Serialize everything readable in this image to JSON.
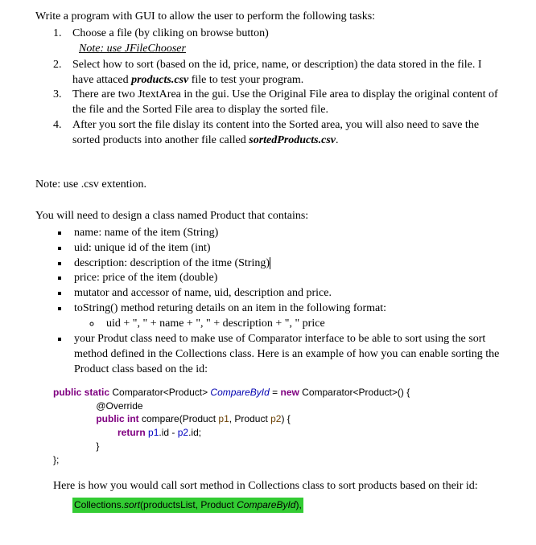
{
  "intro": "Write a program with GUI to allow the user to perform the following tasks:",
  "items": {
    "i1a": "Choose a file (by cliking on browse button)",
    "i1_note": "Note: use JFileChooser",
    "i2a": "Select how to sort (based on the id, price, name, or description) the data stored in the file. I have attaced ",
    "i2_prod": "products.csv",
    "i2b": " file to test your program.",
    "i3": "There are two JtextArea in the gui. Use the Original File area to display the original content of the file and the Sorted File area to display the sorted file.",
    "i4a": "After you sort the file dislay its content into the Sorted area, you will also need to save the sorted products into another file called ",
    "i4_sorted": "sortedProducts.csv",
    "i4b": "."
  },
  "note_csv": "Note: use .csv extention.",
  "design_intro": "You will need to design a class named Product that contains:",
  "bullets": {
    "b1": "name: name of the item (String)",
    "b2": "uid: unique id of  the item (int)",
    "b3": "description: description of the itme (String)",
    "b4": "price: price of the item (double)",
    "b5": "mutator and accessor of name, uid, description and price.",
    "b6": "toString() method returing details on an item in the following format:",
    "b6_sub": "uid + \", \" + name + \", \" + description + \", \" price",
    "b7": "your Produt class need to make use of Comparator interface to be able to sort using the sort method defined in the Collections class. Here is an example of how you can enable sorting the Product class based on the id:"
  },
  "code": {
    "kw_public_static": "public static",
    "type_comp": " Comparator<Product> ",
    "compbyid": "CompareById",
    "eq": " = ",
    "kw_new": "new",
    "comp_ctor": " Comparator<Product>() {",
    "override": "                @Override",
    "kw_public_int": "public int",
    "compare_sig1": " compare(Product ",
    "p1": "p1",
    "comma": ", Product ",
    "p2": "p2",
    "close_paren": ") {",
    "kw_return": "return",
    "p1o": " p1",
    "dot_id1": ".id",
    "minus": " - ",
    "p2o": "p2",
    "dot_id2": ".id",
    "semi": ";",
    "close_brace": "                }",
    "close_outer": "};"
  },
  "call_intro": "Here is how you would call sort method in Collections class to sort products based on their id:",
  "hl": {
    "a": "Collections.",
    "sort": "sort",
    "b": "(productsList, Product ",
    "c": "CompareById",
    "d": "),"
  }
}
